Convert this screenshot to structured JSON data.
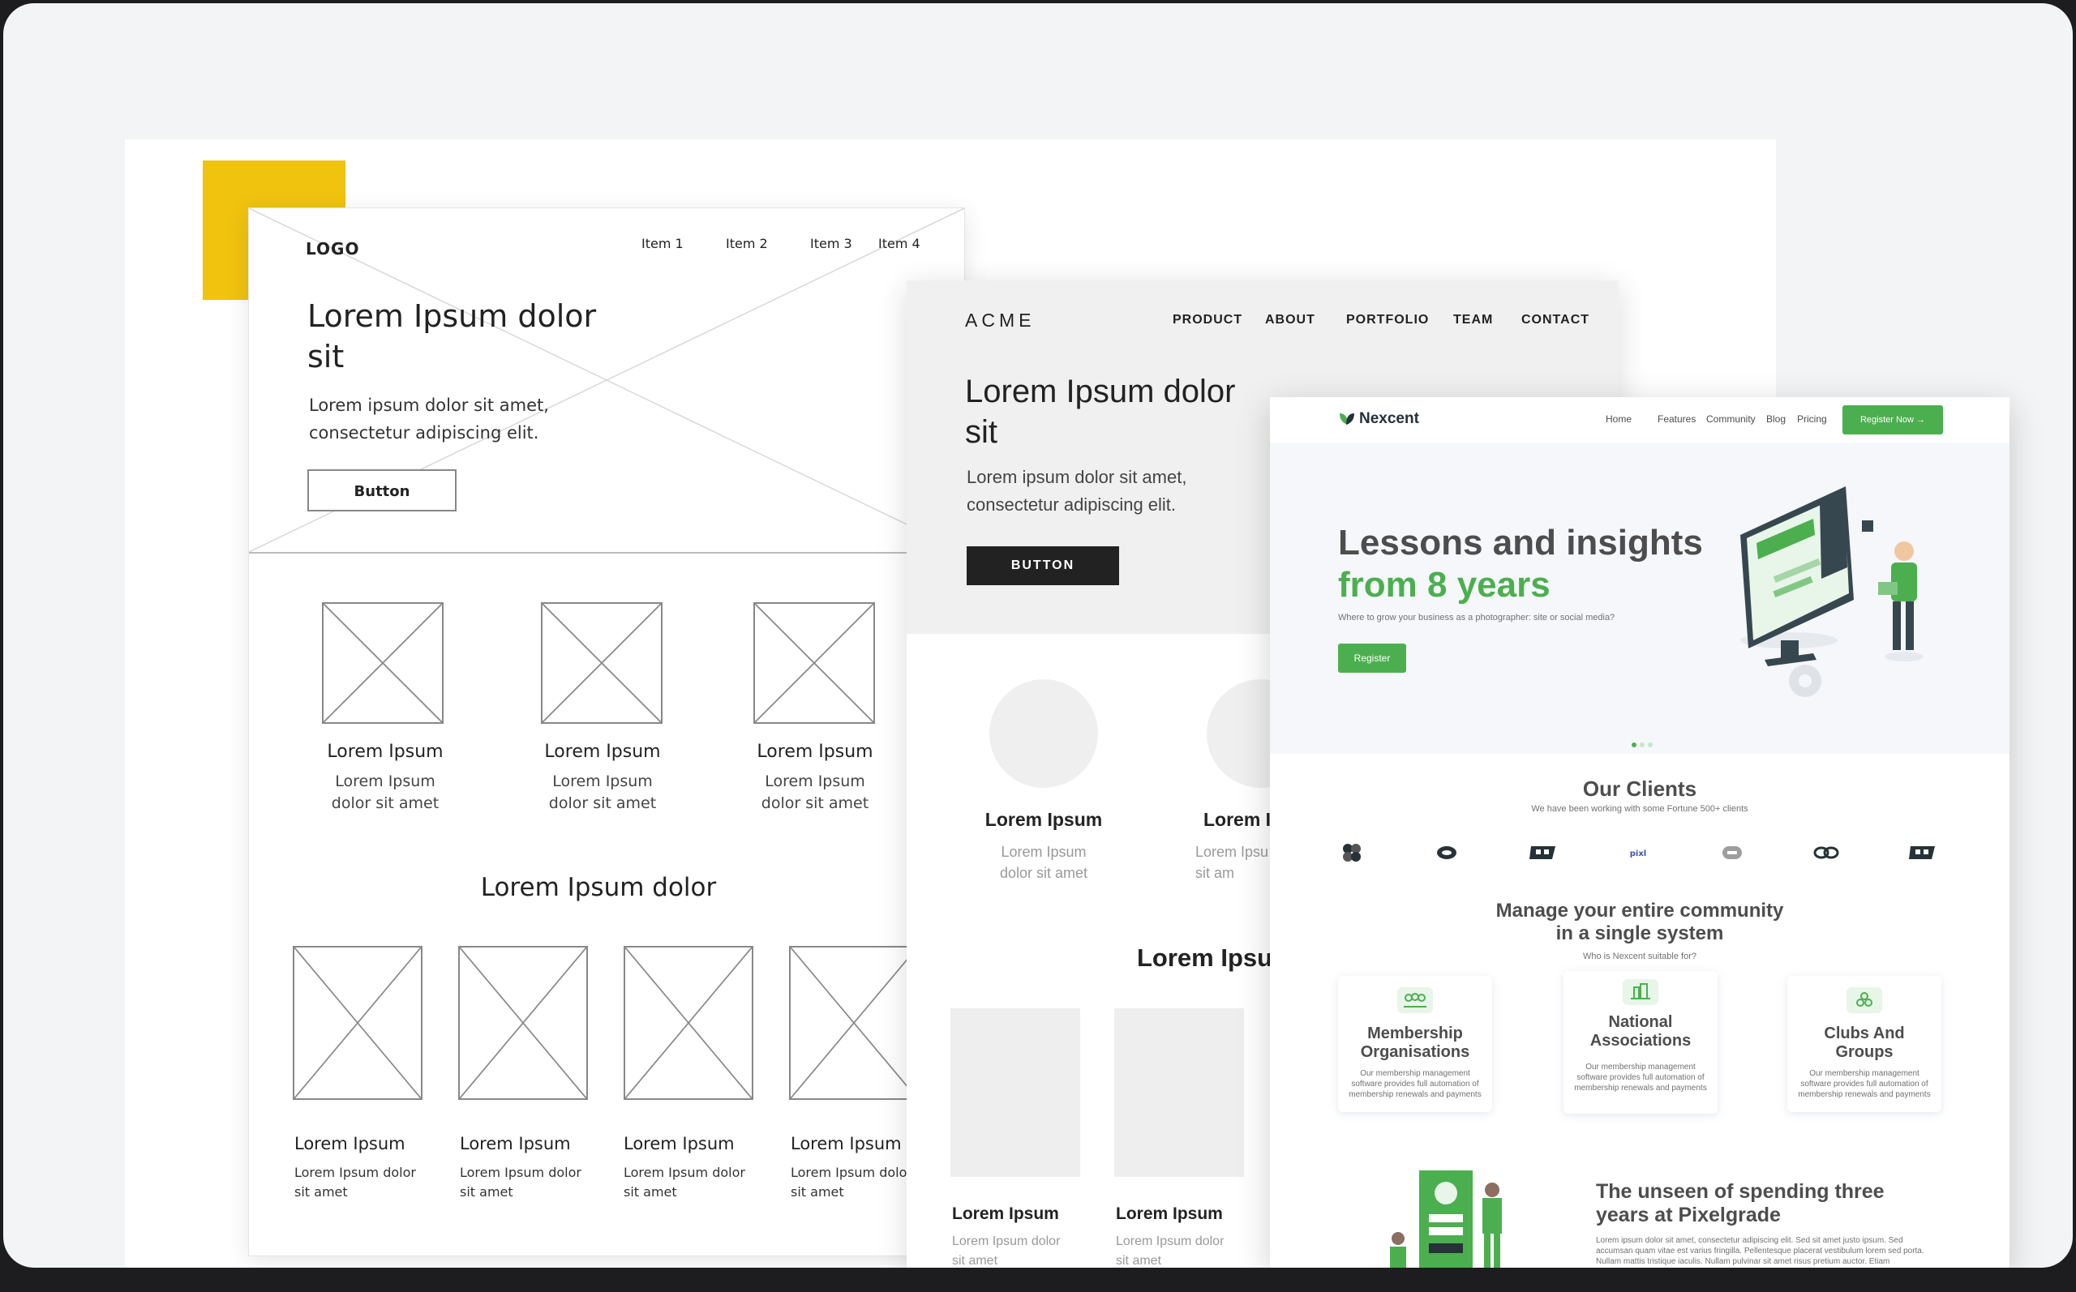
{
  "wireframe": {
    "logo": "LOGO",
    "nav": [
      "Item 1",
      "Item 2",
      "Item 3",
      "Item 4"
    ],
    "hero_title": "Lorem Ipsum dolor sit",
    "hero_text": "Lorem ipsum dolor sit amet, consectetur adipiscing elit.",
    "button": "Button",
    "features": [
      {
        "title": "Lorem Ipsum",
        "text": "Lorem Ipsum dolor sit amet"
      },
      {
        "title": "Lorem Ipsum",
        "text": "Lorem Ipsum dolor sit amet"
      },
      {
        "title": "Lorem Ipsum",
        "text": "Lorem Ipsum dolor sit amet"
      }
    ],
    "section_title": "Lorem Ipsum dolor",
    "cards": [
      {
        "title": "Lorem Ipsum",
        "text": "Lorem Ipsum dolor sit amet"
      },
      {
        "title": "Lorem Ipsum",
        "text": "Lorem Ipsum dolor sit amet"
      },
      {
        "title": "Lorem Ipsum",
        "text": "Lorem Ipsum dolor sit amet"
      },
      {
        "title": "Lorem Ipsum",
        "text": "Lorem Ipsum dolor sit amet"
      }
    ]
  },
  "acme": {
    "logo": "ACME",
    "nav": [
      "PRODUCT",
      "ABOUT",
      "PORTFOLIO",
      "TEAM",
      "CONTACT"
    ],
    "hero_title": "Lorem Ipsum dolor sit",
    "hero_text": "Lorem ipsum dolor sit amet, consectetur adipiscing elit.",
    "button": "BUTTON",
    "features": [
      {
        "title": "Lorem Ipsum",
        "text": "Lorem Ipsum dolor sit amet"
      },
      {
        "title": "Lorem I",
        "text": "Lorem Ipsu sit am"
      }
    ],
    "section_title": "Lorem Ipsu",
    "cards": [
      {
        "title": "Lorem Ipsum",
        "text": "Lorem Ipsum dolor sit amet"
      },
      {
        "title": "Lorem Ipsum",
        "text": "Lorem Ipsum dolor sit amet"
      }
    ]
  },
  "nexcent": {
    "logo": "Nexcent",
    "nav": [
      "Home",
      "Features",
      "Community",
      "Blog",
      "Pricing"
    ],
    "register_now": "Register Now →",
    "hero_title_1": "Lessons and insights",
    "hero_title_2": "from 8 years",
    "hero_subtitle": "Where to grow your business as a photographer: site or social media?",
    "hero_button": "Register",
    "clients_title": "Our Clients",
    "clients_subtitle": "We have been working with some Fortune 500+ clients",
    "client_logos": [
      "client-logo-1",
      "client-logo-2",
      "client-logo-3",
      "client-logo-4",
      "client-logo-5",
      "client-logo-6",
      "client-logo-7"
    ],
    "community_title_1": "Manage your entire community",
    "community_title_2": "in a single system",
    "community_subtitle": "Who is Nexcent suitable for?",
    "cards": [
      {
        "title": "Membership Organisations",
        "text": "Our membership management software provides full automation of membership renewals and payments",
        "icon": "people-icon"
      },
      {
        "title": "National Associations",
        "text": "Our membership management software provides full automation of membership renewals and payments",
        "icon": "building-icon"
      },
      {
        "title": "Clubs And Groups",
        "text": "Our membership management software provides full automation of membership renewals and payments",
        "icon": "hand-icon"
      }
    ],
    "unseen_title": "The unseen of spending three years at Pixelgrade",
    "unseen_text": "Lorem ipsum dolor sit amet, consectetur adipiscing elit. Sed sit amet justo ipsum. Sed accumsan quam vitae est varius fringilla. Pellentesque placerat vestibulum lorem sed porta. Nullam mattis tristique iaculis. Nullam pulvinar sit amet risus pretium auctor. Etiam",
    "accent": "#4caf4f"
  },
  "colors": {
    "yellow_accent": "#f0c30f",
    "acme_button": "#222222"
  }
}
